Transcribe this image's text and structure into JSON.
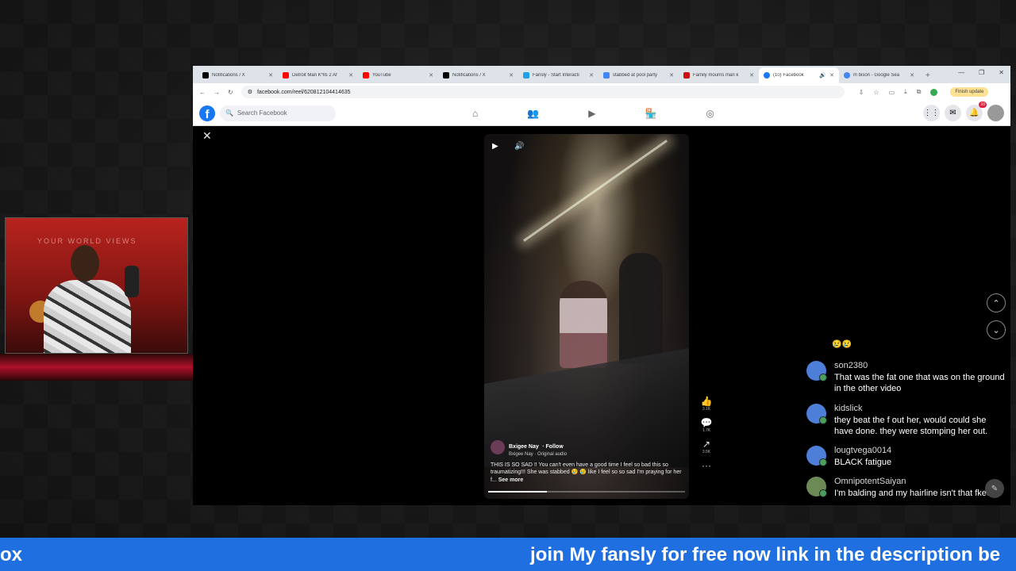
{
  "browser": {
    "tabs": [
      {
        "label": "Notifications / X",
        "color": "#000000"
      },
      {
        "label": "Detroit Man K*lls 2 Af",
        "color": "#ff0000"
      },
      {
        "label": "YouTube",
        "color": "#ff0000"
      },
      {
        "label": "Notifications / X",
        "color": "#000000"
      },
      {
        "label": "Fansly - Start Interacti",
        "color": "#1fa0e8"
      },
      {
        "label": "stabbed at pool party",
        "color": "#4285f4"
      },
      {
        "label": "Family mourns man k",
        "color": "#cc1111"
      },
      {
        "label": "(10) Facebook",
        "color": "#1877f2"
      },
      {
        "label": "m bison - Google Sea",
        "color": "#4285f4"
      }
    ],
    "new_tab": "+",
    "url": "facebook.com/reel/620812104414635",
    "finish_update": "Finish update"
  },
  "facebook": {
    "search_placeholder": "Search Facebook",
    "logo": "f",
    "notification_count": "10"
  },
  "reel": {
    "author": "Bxigee Nay",
    "follow": "· Follow",
    "audio": "Bxigee Nay · Original audio",
    "caption": "THIS IS SO SAD !! You can't even have a good time I feel so bad this so traumatizing!!! She was stabbed 😢 😢 like I feel so so sad I'm praying for her f...",
    "see_more": "See more",
    "progress": 0.3,
    "likes": "3.1K",
    "comments": "1.7K",
    "shares": "3.5K",
    "more": "···"
  },
  "webcam": {
    "wall_text": "YOUR WORLD VIEWS"
  },
  "chat": {
    "top_emoji": "😢😢",
    "messages": [
      {
        "user": "son2380",
        "text": "That was the fat one that was on the ground in the other video"
      },
      {
        "user": "kidslick",
        "text": "they beat the f out her, would could she have done. they were stomping her out."
      },
      {
        "user": "lougtvega0014",
        "text": "BLACK fatigue"
      },
      {
        "user": "OmnipotentSaiyan",
        "text": "I'm balding and my hairline isn't that fked"
      }
    ]
  },
  "ticker": {
    "left_text": "ox",
    "main_text": "join My fansly for free now link in the description be"
  }
}
